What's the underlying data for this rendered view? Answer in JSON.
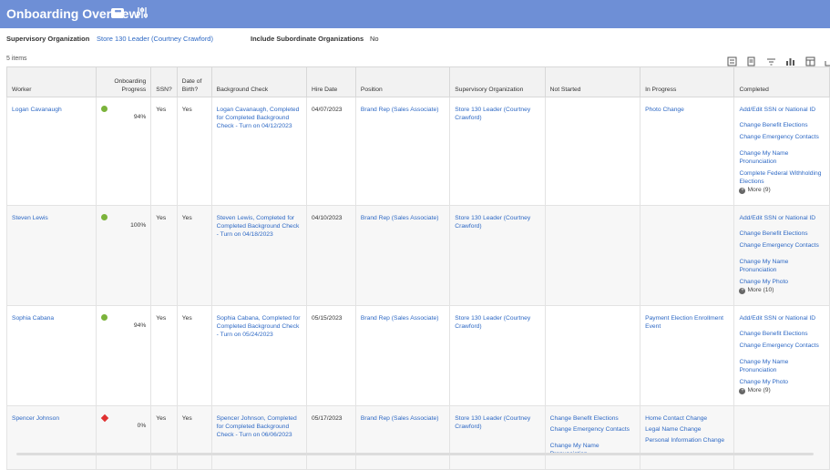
{
  "header": {
    "title": "Onboarding Overview"
  },
  "org": {
    "label": "Supervisory Organization",
    "value": "Store 130 Leader (Courtney Crawford)",
    "sub_label": "Include Subordinate Organizations",
    "sub_value": "No"
  },
  "items_count": "5 items",
  "columns": [
    "Worker",
    "Onboarding Progress",
    "SSN?",
    "Date of Birth?",
    "Background Check",
    "Hire Date",
    "Position",
    "Supervisory Organization",
    "Not Started",
    "In Progress",
    "Completed"
  ],
  "rows": [
    {
      "worker": "Logan Cavanaugh",
      "status": "green",
      "progress": "94%",
      "ssn": "Yes",
      "dob": "Yes",
      "bg": "Logan Cavanaugh, Completed for Completed Background Check - Turn on 04/12/2023",
      "hire": "04/07/2023",
      "position": "Brand Rep (Sales Associate)",
      "org": "Store 130 Leader (Courtney Crawford)",
      "not_started": [],
      "in_progress": [
        "Photo Change"
      ],
      "completed": [
        "Add/Edit SSN or National ID",
        "Change Benefit Elections",
        "Change Emergency Contacts",
        "Change My Name Pronunciation",
        "Complete Federal Withholding Elections"
      ],
      "more": "More (9)"
    },
    {
      "worker": "Steven Lewis",
      "status": "green",
      "progress": "100%",
      "ssn": "Yes",
      "dob": "Yes",
      "bg": "Steven Lewis, Completed for Completed Background Check - Turn on 04/18/2023",
      "hire": "04/10/2023",
      "position": "Brand Rep (Sales Associate)",
      "org": "Store 130 Leader (Courtney Crawford)",
      "not_started": [],
      "in_progress": [],
      "completed": [
        "Add/Edit SSN or National ID",
        "Change Benefit Elections",
        "Change Emergency Contacts",
        "Change My Name Pronunciation",
        "Change My Photo"
      ],
      "more": "More (10)"
    },
    {
      "worker": "Sophia Cabana",
      "status": "green",
      "progress": "94%",
      "ssn": "Yes",
      "dob": "Yes",
      "bg": "Sophia Cabana, Completed for Completed Background Check - Turn on 05/24/2023",
      "hire": "05/15/2023",
      "position": "Brand Rep (Sales Associate)",
      "org": "Store 130 Leader (Courtney Crawford)",
      "not_started": [],
      "in_progress": [
        "Payment Election Enrollment Event"
      ],
      "completed": [
        "Add/Edit SSN or National ID",
        "Change Benefit Elections",
        "Change Emergency Contacts",
        "Change My Name Pronunciation",
        "Change My Photo"
      ],
      "more": "More (9)"
    },
    {
      "worker": "Spencer Johnson",
      "status": "red",
      "progress": "0%",
      "ssn": "Yes",
      "dob": "Yes",
      "bg": "Spencer Johnson, Completed for Completed Background Check - Turn on 06/06/2023",
      "hire": "05/17/2023",
      "position": "Brand Rep (Sales Associate)",
      "org": "Store 130 Leader (Courtney Crawford)",
      "not_started": [
        "Change Benefit Elections",
        "Change Emergency Contacts",
        "Change My Name Pronunciation"
      ],
      "in_progress": [
        "Home Contact Change",
        "Legal Name Change",
        "Personal Information Change"
      ],
      "completed": [],
      "more": ""
    }
  ],
  "colors": {
    "header": "#6e8fd6",
    "link": "#2d68c4",
    "ok": "#7bb33b",
    "bad": "#e03131"
  },
  "icons": [
    "related-actions-icon",
    "filter-settings-icon",
    "excel-export-icon",
    "pdf-export-icon",
    "filter-icon",
    "chart-icon",
    "grid-view-icon",
    "fullscreen-icon"
  ]
}
